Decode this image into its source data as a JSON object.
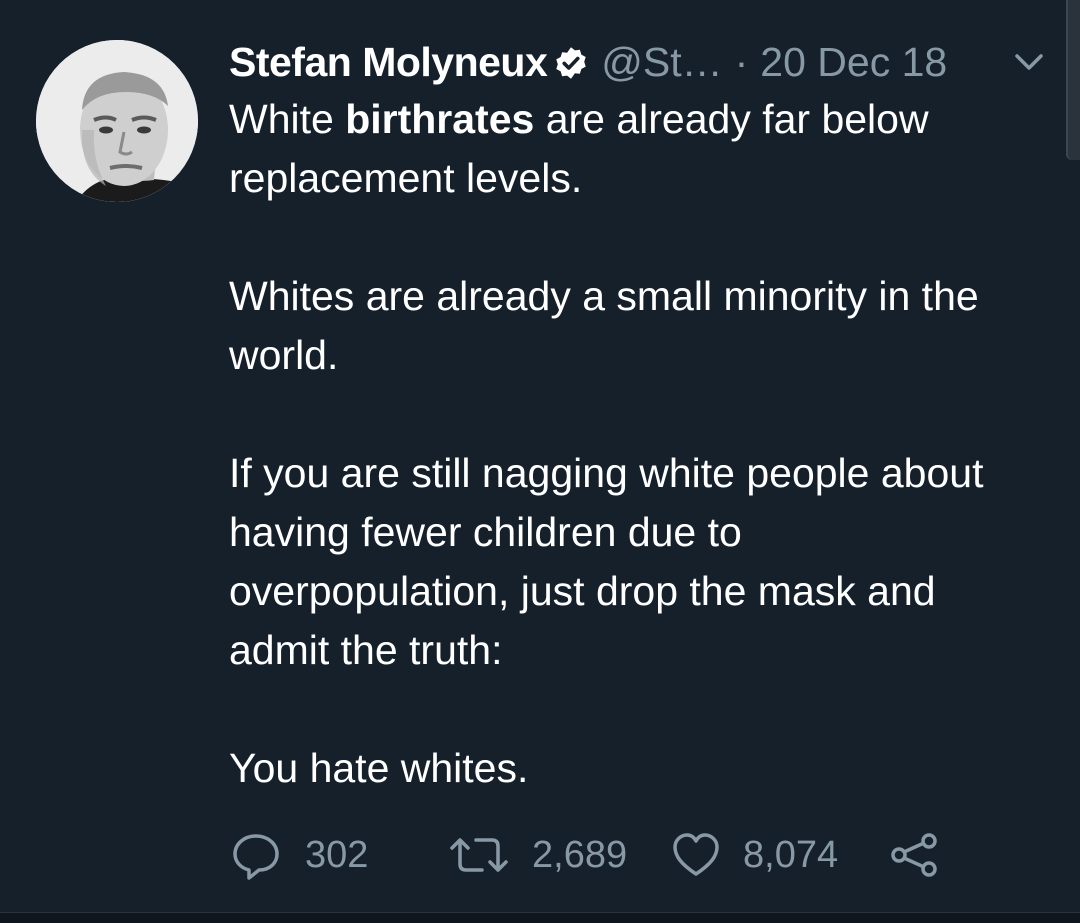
{
  "tweet": {
    "author_name": "Stefan Molyneux",
    "handle": "@St…",
    "separator": "·",
    "date": "20 Dec 18",
    "verified": true,
    "body": {
      "p1_pre": "White ",
      "p1_bold": "birthrates",
      "p1_post": " are already far below replacement levels.",
      "p2": "Whites are already a small minority in the world.",
      "p3": "If you are still nagging white people about having fewer children due to overpopulation, just drop the mask and admit the truth:",
      "p4": "You hate whites."
    },
    "actions": {
      "replies": "302",
      "retweets": "2,689",
      "likes": "8,074"
    }
  },
  "icons": {
    "verified": "verified-badge-icon",
    "more": "chevron-down-icon",
    "reply": "reply-icon",
    "retweet": "retweet-icon",
    "like": "heart-icon",
    "share": "share-icon"
  },
  "colors": {
    "background": "#16202b",
    "text": "#ffffff",
    "muted": "#8899a6"
  }
}
